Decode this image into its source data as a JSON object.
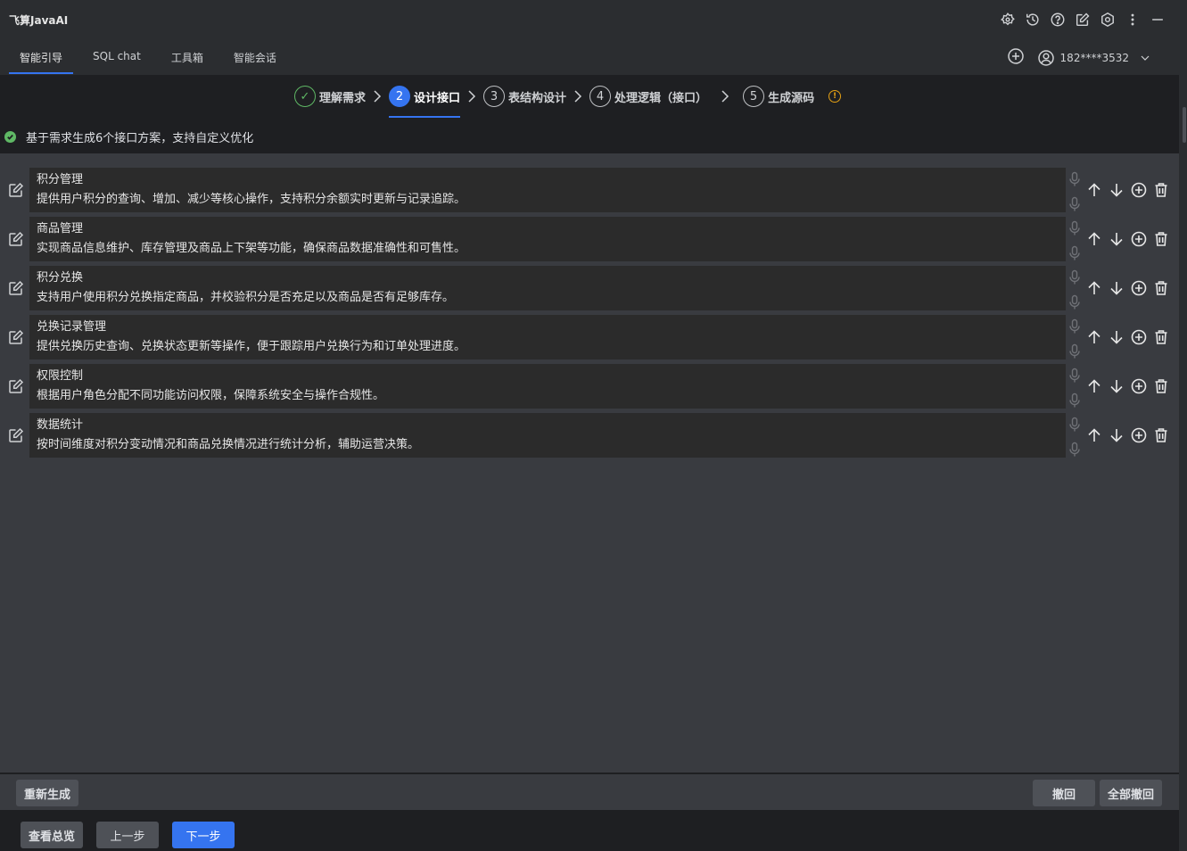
{
  "app": {
    "title": "飞算JavaAI"
  },
  "title_icons": [
    "plugin-icon",
    "history-icon",
    "help-icon",
    "edit-icon",
    "settings-icon",
    "more-icon",
    "minimize-icon"
  ],
  "tabs": [
    {
      "label": "智能引导",
      "active": true
    },
    {
      "label": "SQL chat",
      "active": false
    },
    {
      "label": "工具箱",
      "active": false
    },
    {
      "label": "智能会话",
      "active": false
    }
  ],
  "user": {
    "name": "182****3532"
  },
  "steps": [
    {
      "num": "✓",
      "label": "理解需求",
      "state": "done"
    },
    {
      "num": "2",
      "label": "设计接口",
      "state": "active"
    },
    {
      "num": "3",
      "label": "表结构设计",
      "state": "pending"
    },
    {
      "num": "4",
      "label": "处理逻辑（接口）",
      "state": "pending"
    },
    {
      "num": "5",
      "label": "生成源码",
      "state": "pending"
    }
  ],
  "notice": {
    "text": "基于需求生成6个接口方案，支持自定义优化"
  },
  "items": [
    {
      "name": "积分管理",
      "desc": "提供用户积分的查询、增加、减少等核心操作，支持积分余额实时更新与记录追踪。"
    },
    {
      "name": "商品管理",
      "desc": "实现商品信息维护、库存管理及商品上下架等功能，确保商品数据准确性和可售性。"
    },
    {
      "name": "积分兑换",
      "desc": "支持用户使用积分兑换指定商品，并校验积分是否充足以及商品是否有足够库存。"
    },
    {
      "name": "兑换记录管理",
      "desc": "提供兑换历史查询、兑换状态更新等操作，便于跟踪用户兑换行为和订单处理进度。"
    },
    {
      "name": "权限控制",
      "desc": "根据用户角色分配不同功能访问权限，保障系统安全与操作合规性。"
    },
    {
      "name": "数据统计",
      "desc": "按时间维度对积分变动情况和商品兑换情况进行统计分析，辅助运营决策。"
    }
  ],
  "buttons": {
    "regenerate": "重新生成",
    "undo": "撤回",
    "undo_all": "全部撤回",
    "overview": "查看总览",
    "prev": "上一步",
    "next": "下一步"
  },
  "colors": {
    "accent": "#3574f0",
    "success": "#5fb865",
    "warning": "#e5a114"
  }
}
